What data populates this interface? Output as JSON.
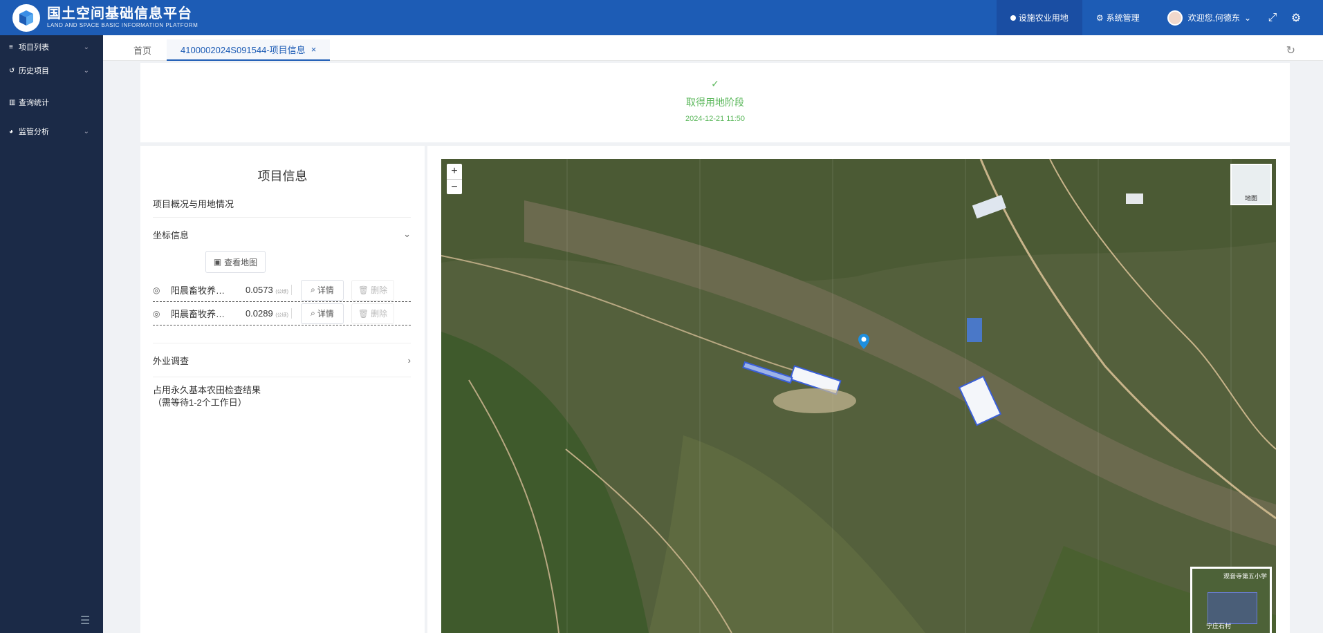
{
  "header": {
    "logo_title": "国土空间基础信息平台",
    "logo_subtitle": "LAND AND SPACE BASIC INFORMATION PLATFORM",
    "nav_active": "设施农业用地",
    "nav_system": "系统管理",
    "user_greeting": "欢迎您,何德东"
  },
  "sidebar": {
    "items": [
      {
        "label": "项目列表",
        "icon": "list-icon",
        "has_children": true
      },
      {
        "label": "历史项目",
        "icon": "history-icon",
        "has_children": true
      },
      {
        "label": "查询统计",
        "icon": "chart-icon",
        "has_children": false
      },
      {
        "label": "监管分析",
        "icon": "pie-icon",
        "has_children": true
      }
    ]
  },
  "tabs": {
    "home": "首页",
    "active": "4100002024S091544-项目信息"
  },
  "status": {
    "stage": "取得用地阶段",
    "datetime": "2024-12-21 11:50"
  },
  "project": {
    "title": "项目信息",
    "overview": "项目概况与用地情况",
    "coord_section": "坐标信息",
    "view_map": "查看地图",
    "coords": [
      {
        "name": "阳晨畜牧养…",
        "value": "0.0573",
        "unit": "(公顷)",
        "detail": "详情",
        "delete": "删除"
      },
      {
        "name": "阳晨畜牧养…",
        "value": "0.0289",
        "unit": "(公顷)",
        "detail": "详情",
        "delete": "删除"
      }
    ],
    "field_survey": "外业调查",
    "occupy_line1": "占用永久基本农田检查结果",
    "occupy_line2": "（需等待1-2个工作日）"
  },
  "map": {
    "basemap_label": "地图",
    "overview_label": "观音寺第五小学",
    "overview_label2": "宁庄石村",
    "accent": "#1d5cb5"
  }
}
